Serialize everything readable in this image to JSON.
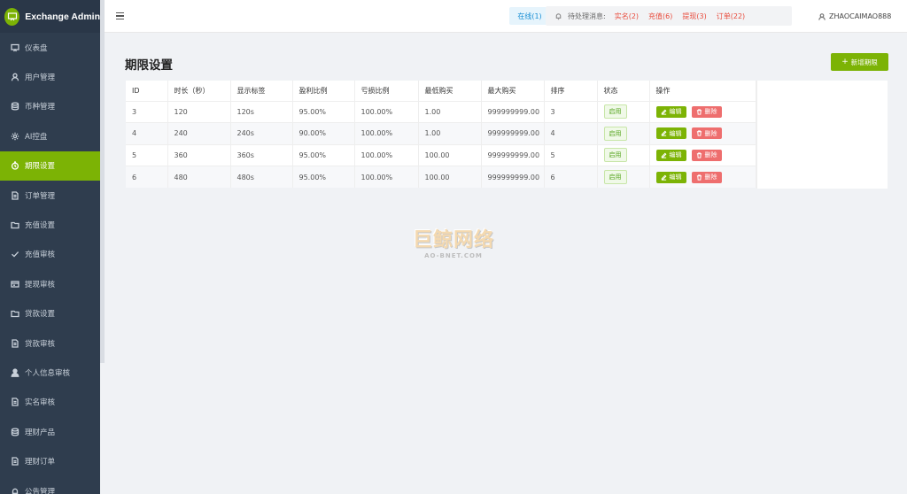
{
  "app": {
    "title": "Exchange Admin",
    "brand_color": "#7cb305",
    "sidebar_color": "#2f3d4e"
  },
  "sidebar": {
    "items": [
      {
        "label": "仪表盘",
        "icon": "dashboard-icon",
        "active": false
      },
      {
        "label": "用户管理",
        "icon": "user-icon",
        "active": false
      },
      {
        "label": "币种管理",
        "icon": "database-icon",
        "active": false
      },
      {
        "label": "AI控盘",
        "icon": "gear-icon",
        "active": false
      },
      {
        "label": "期限设置",
        "icon": "timer-icon",
        "active": true
      },
      {
        "label": "订单管理",
        "icon": "document-icon",
        "active": false
      },
      {
        "label": "充值设置",
        "icon": "folder-icon",
        "active": false
      },
      {
        "label": "充值审核",
        "icon": "check-icon",
        "active": false
      },
      {
        "label": "提现审核",
        "icon": "card-icon",
        "active": false
      },
      {
        "label": "贷款设置",
        "icon": "folder-icon",
        "active": false
      },
      {
        "label": "贷款审核",
        "icon": "document-icon",
        "active": false
      },
      {
        "label": "个人信息审核",
        "icon": "person-icon",
        "active": false
      },
      {
        "label": "实名审核",
        "icon": "document-icon",
        "active": false
      },
      {
        "label": "理财产品",
        "icon": "database-icon",
        "active": false
      },
      {
        "label": "理财订单",
        "icon": "document-icon",
        "active": false
      },
      {
        "label": "公告管理",
        "icon": "bell-icon",
        "active": false
      }
    ]
  },
  "header": {
    "online": "在线(1)",
    "pending_label": "待处理消息:",
    "links": [
      "实名(2)",
      "充值(6)",
      "提现(3)",
      "订单(22)"
    ],
    "username": "ZHAOCAIMAO888"
  },
  "main": {
    "title": "期限设置",
    "add_button": "新增期限",
    "columns": [
      "ID",
      "时长（秒）",
      "显示标签",
      "盈利比例",
      "亏损比例",
      "最低购买",
      "最大购买",
      "排序",
      "状态",
      "操作"
    ],
    "rows": [
      [
        "3",
        "120",
        "120s",
        "95.00%",
        "100.00%",
        "1.00",
        "999999999.00",
        "3",
        "启用"
      ],
      [
        "4",
        "240",
        "240s",
        "90.00%",
        "100.00%",
        "1.00",
        "999999999.00",
        "4",
        "启用"
      ],
      [
        "5",
        "360",
        "360s",
        "95.00%",
        "100.00%",
        "100.00",
        "999999999.00",
        "5",
        "启用"
      ],
      [
        "6",
        "480",
        "480s",
        "95.00%",
        "100.00%",
        "100.00",
        "999999999.00",
        "6",
        "启用"
      ]
    ],
    "edit_label": "编辑",
    "delete_label": "删除"
  },
  "watermark": {
    "line1": "巨鲸网络",
    "line2": "AO-BNET.COM"
  }
}
